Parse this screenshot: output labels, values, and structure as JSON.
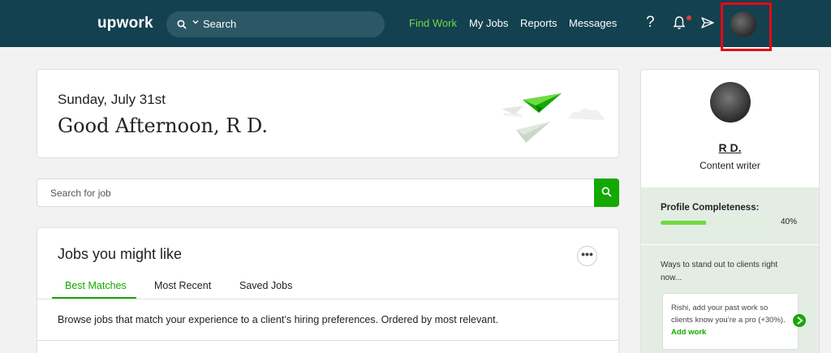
{
  "nav": {
    "logo": "upwork",
    "search_label": "Search",
    "links": {
      "find_work": "Find Work",
      "my_jobs": "My Jobs",
      "reports": "Reports",
      "messages": "Messages"
    },
    "help": "?",
    "icons": [
      "search-icon",
      "chevron-down-icon",
      "help-icon",
      "bell-icon",
      "send-icon",
      "avatar"
    ]
  },
  "greeting": {
    "date": "Sunday, July 31st",
    "message": "Good Afternoon, R D."
  },
  "job_search": {
    "placeholder": "Search for job"
  },
  "jobs": {
    "title": "Jobs you might like",
    "more": "•••",
    "tabs": [
      "Best Matches",
      "Most Recent",
      "Saved Jobs"
    ],
    "active_tab": "Best Matches",
    "description": "Browse jobs that match your experience to a client’s hiring preferences. Ordered by most relevant."
  },
  "profile": {
    "name": "R D.",
    "title": "Content writer",
    "completeness_label": "Profile Completeness:",
    "completeness_fraction": 0.4,
    "completeness_text": "40%",
    "ways_text": "Ways to stand out to clients right now...",
    "tip_text": "Rishi, add your past work so clients know you’re a pro (+30%).",
    "tip_link": "Add work"
  },
  "colors": {
    "nav_bg": "#13414f",
    "accent_green": "#14a800",
    "light_green": "#6fda44",
    "highlight_box": "#e50914"
  }
}
